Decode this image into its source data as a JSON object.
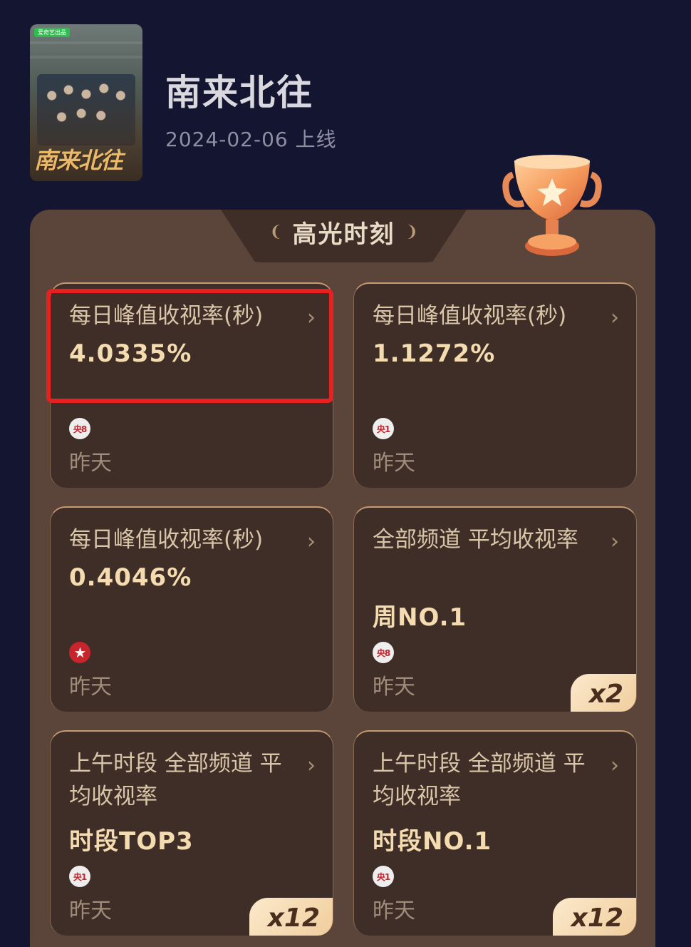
{
  "show": {
    "title": "南来北往",
    "date": "2024-02-06 上线",
    "poster_text": "南来北往",
    "poster_badge": "爱奇艺出品"
  },
  "section": {
    "title": "高光时刻"
  },
  "cards": [
    {
      "label": "每日峰值收视率(秒)",
      "value": "4.0335%",
      "channel": "央8",
      "when": "昨天",
      "multiplier": ""
    },
    {
      "label": "每日峰值收视率(秒)",
      "value": "1.1272%",
      "channel": "央1",
      "when": "昨天",
      "multiplier": ""
    },
    {
      "label": "每日峰值收视率(秒)",
      "value": "0.4046%",
      "channel": "★",
      "when": "昨天",
      "multiplier": ""
    },
    {
      "label": "全部频道 平均收视率",
      "value": "周NO.1",
      "channel": "央8",
      "when": "昨天",
      "multiplier": "x2"
    },
    {
      "label": "上午时段 全部频道 平均收视率",
      "value": "时段TOP3",
      "channel": "央1",
      "when": "昨天",
      "multiplier": "x12"
    },
    {
      "label": "上午时段 全部频道 平均收视率",
      "value": "时段NO.1",
      "channel": "央1",
      "when": "昨天",
      "multiplier": "x12"
    }
  ],
  "colors": {
    "background": "#141530",
    "panel": "#5b443a",
    "card": "#3f2e27",
    "value_text": "#f4dcb0",
    "highlight_box": "#e8201f"
  },
  "icons": [
    "trophy-icon",
    "laurel-left-icon",
    "laurel-right-icon",
    "chevron-right-icon",
    "channel-logo-icon",
    "star-channel-icon"
  ]
}
